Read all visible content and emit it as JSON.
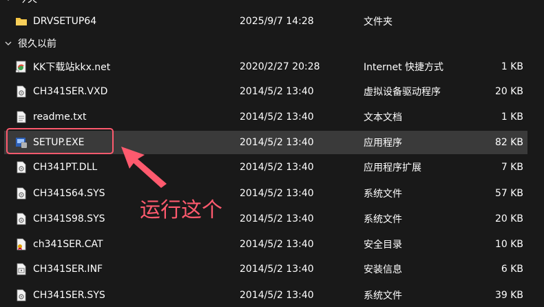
{
  "groups": [
    {
      "label": "今天",
      "collapsed": false
    },
    {
      "label": "很久以前",
      "collapsed": false
    }
  ],
  "files": [
    {
      "name": "DRVSETUP64",
      "date": "2025/9/7 14:28",
      "type": "文件夹",
      "size": "",
      "icon": "folder-icon"
    },
    {
      "name": "KK下载站kkx.net",
      "date": "2020/2/27 20:28",
      "type": "Internet 快捷方式",
      "size": "1 KB",
      "icon": "internet-shortcut-icon"
    },
    {
      "name": "CH341SER.VXD",
      "date": "2014/5/2 13:40",
      "type": "虚拟设备驱动程序",
      "size": "20 KB",
      "icon": "system-file-icon"
    },
    {
      "name": "readme.txt",
      "date": "2014/5/2 13:40",
      "type": "文本文档",
      "size": "1 KB",
      "icon": "text-file-icon"
    },
    {
      "name": "SETUP.EXE",
      "date": "2014/5/2 13:40",
      "type": "应用程序",
      "size": "82 KB",
      "icon": "setup-exe-icon"
    },
    {
      "name": "CH341PT.DLL",
      "date": "2014/5/2 13:40",
      "type": "应用程序扩展",
      "size": "7 KB",
      "icon": "system-file-icon"
    },
    {
      "name": "CH341S64.SYS",
      "date": "2014/5/2 13:40",
      "type": "系统文件",
      "size": "57 KB",
      "icon": "system-file-icon"
    },
    {
      "name": "CH341S98.SYS",
      "date": "2014/5/2 13:40",
      "type": "系统文件",
      "size": "20 KB",
      "icon": "system-file-icon"
    },
    {
      "name": "ch341SER.CAT",
      "date": "2014/5/2 13:40",
      "type": "安全目录",
      "size": "10 KB",
      "icon": "security-catalog-icon"
    },
    {
      "name": "CH341SER.INF",
      "date": "2014/5/2 13:40",
      "type": "安装信息",
      "size": "6 KB",
      "icon": "setup-info-icon"
    },
    {
      "name": "CH341SER.SYS",
      "date": "2014/5/2 13:40",
      "type": "系统文件",
      "size": "39 KB",
      "icon": "system-file-icon"
    }
  ],
  "annotation": {
    "text": "运行这个",
    "color": "#ff5a6e"
  },
  "colors": {
    "background": "#191919",
    "selected_row": "#3a3a3a",
    "text": "#ffffff",
    "folder": "#f5c542"
  }
}
